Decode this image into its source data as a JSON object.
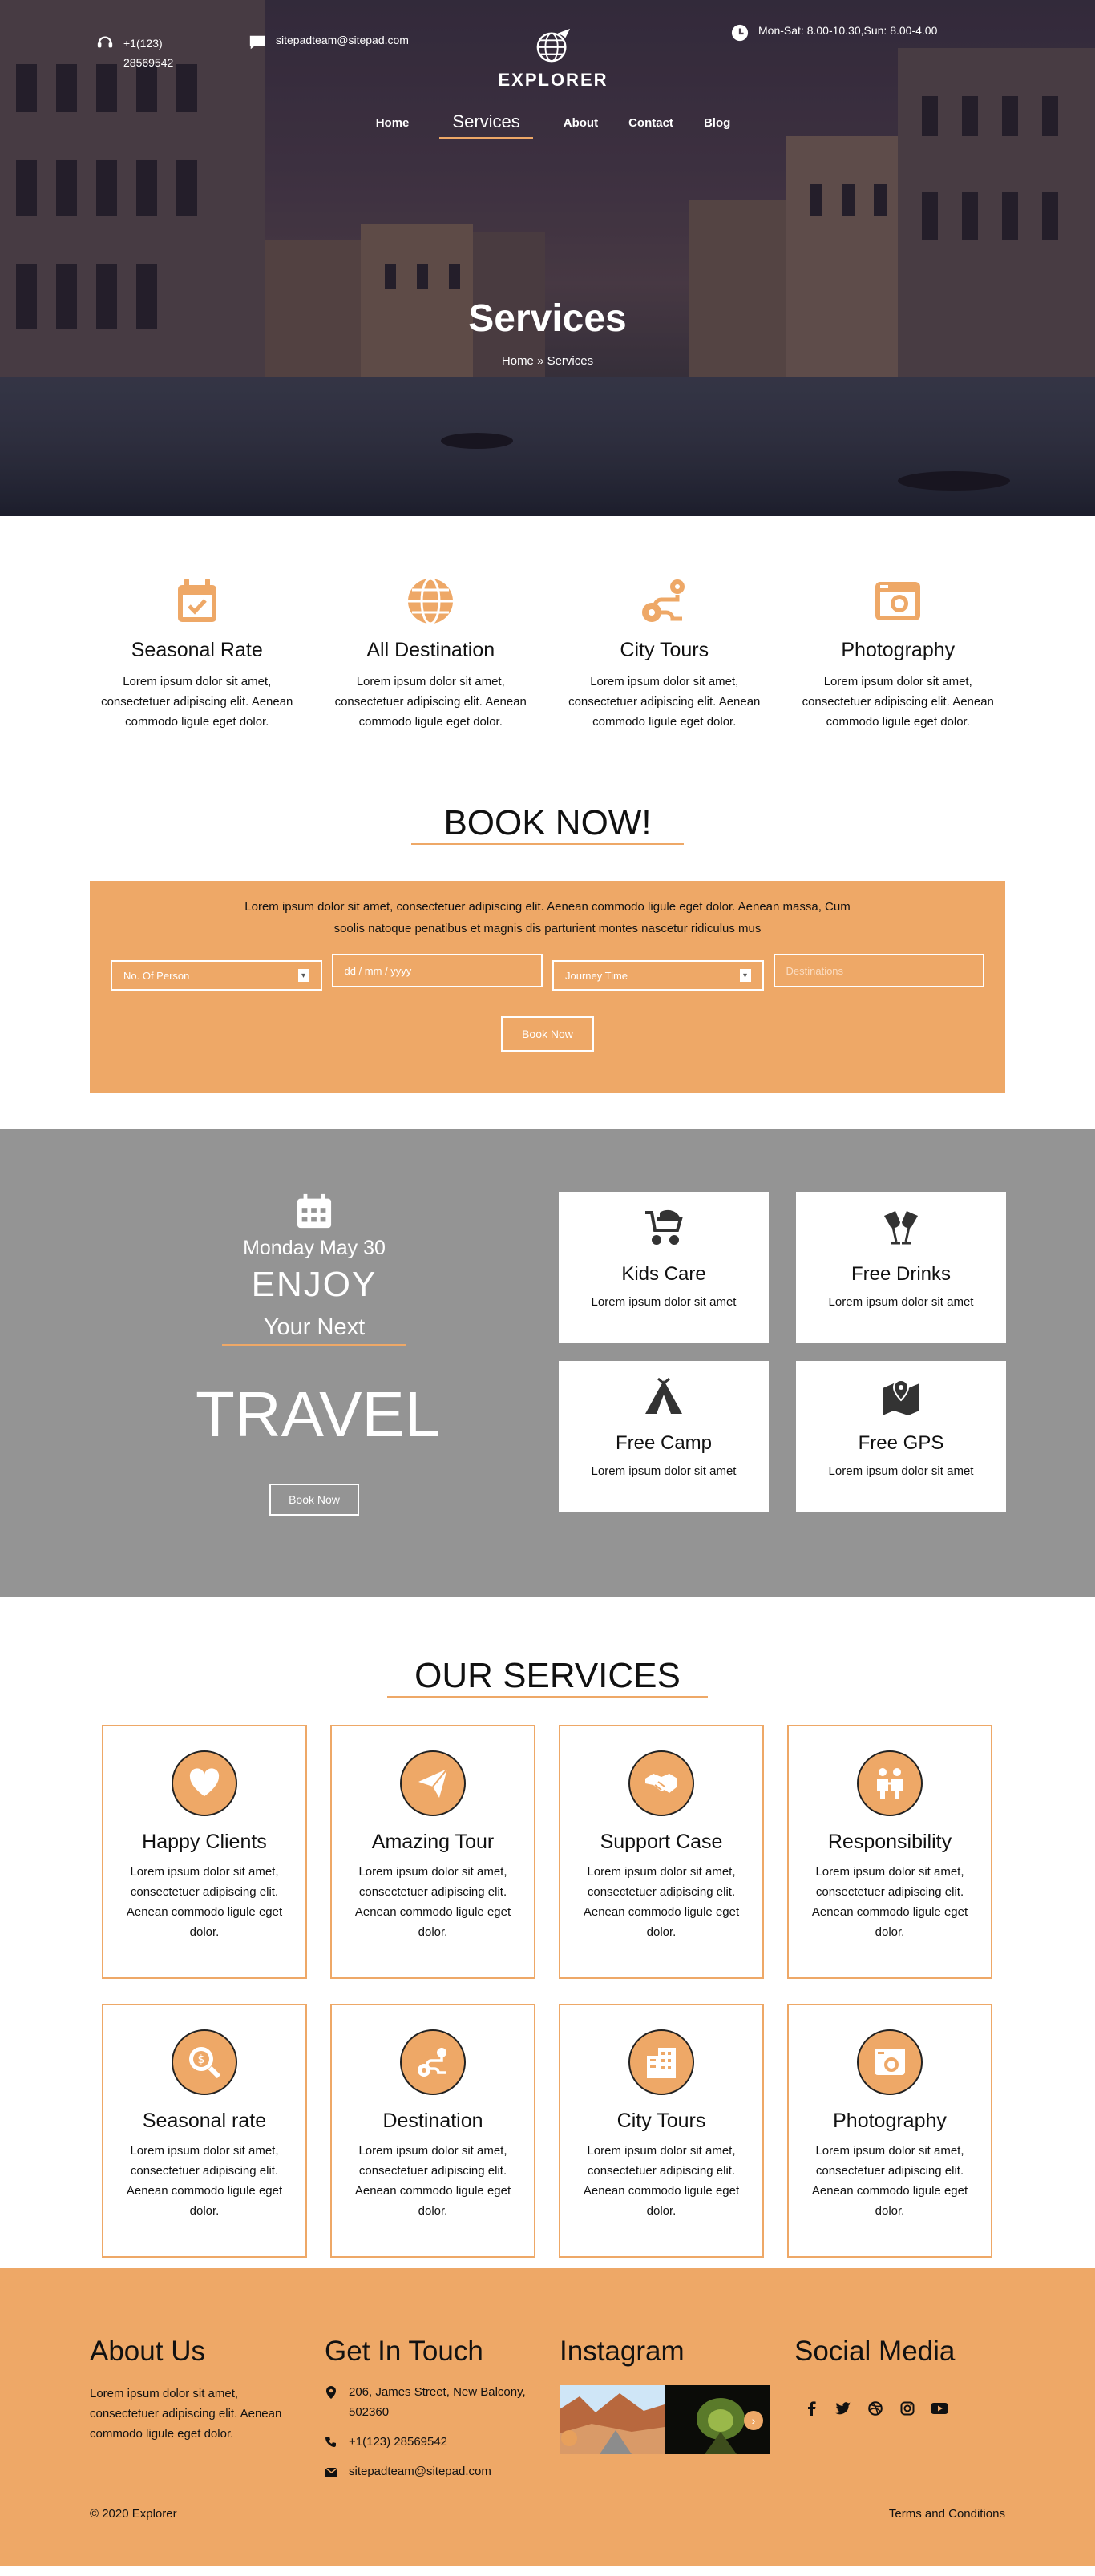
{
  "topbar": {
    "phone": "+1(123) 28569542",
    "email": "sitepadteam@sitepad.com",
    "hours": "Mon-Sat: 8.00-10.30,Sun: 8.00-4.00"
  },
  "brand": {
    "name": "EXPLORER"
  },
  "nav": [
    {
      "label": "Home"
    },
    {
      "label": "Services"
    },
    {
      "label": "About"
    },
    {
      "label": "Contact"
    },
    {
      "label": "Blog"
    }
  ],
  "hero": {
    "title": "Services",
    "breadcrumb": "Home » Services"
  },
  "features": [
    {
      "icon": "calendar-check-icon",
      "title": "Seasonal Rate",
      "text": "Lorem ipsum dolor sit amet, consectetuer adipiscing elit. Aenean commodo ligule eget dolor."
    },
    {
      "icon": "globe-icon",
      "title": "All Destination",
      "text": "Lorem ipsum dolor sit amet, consectetuer adipiscing elit. Aenean commodo ligule eget dolor."
    },
    {
      "icon": "route-icon",
      "title": "City Tours",
      "text": "Lorem ipsum dolor sit amet, consectetuer adipiscing elit. Aenean commodo ligule eget dolor."
    },
    {
      "icon": "camera-icon",
      "title": "Photography",
      "text": "Lorem ipsum dolor sit amet, consectetuer adipiscing elit. Aenean commodo ligule eget dolor."
    }
  ],
  "book": {
    "title": "BOOK NOW!",
    "text": "Lorem ipsum dolor sit amet, consectetuer adipiscing elit. Aenean commodo ligule eget dolor. Aenean massa, Cum soolis natoque penatibus et magnis dis parturient montes nascetur ridiculus mus",
    "persons": "No. Of Person",
    "date": "dd / mm / yyyy",
    "time": "Journey Time",
    "destination_placeholder": "Destinations",
    "button": "Book Now"
  },
  "promo": {
    "date": "Monday May 30",
    "enjoy": "ENJOY",
    "your_next": "Your Next",
    "travel": "TRAVEL",
    "button": "Book Now",
    "cards": [
      {
        "icon": "stroller-icon",
        "title": "Kids Care",
        "text": "Lorem ipsum dolor sit amet"
      },
      {
        "icon": "drinks-icon",
        "title": "Free Drinks",
        "text": "Lorem ipsum dolor sit amet"
      },
      {
        "icon": "tent-icon",
        "title": "Free Camp",
        "text": "Lorem ipsum dolor sit amet"
      },
      {
        "icon": "map-pin-icon",
        "title": "Free GPS",
        "text": "Lorem ipsum dolor sit amet"
      }
    ]
  },
  "services": {
    "title": "OUR SERVICES",
    "items": [
      {
        "icon": "heart-icon",
        "title": "Happy Clients",
        "text": "Lorem ipsum dolor sit amet, consectetuer adipiscing elit. Aenean commodo ligule eget dolor."
      },
      {
        "icon": "paper-plane-icon",
        "title": "Amazing Tour",
        "text": "Lorem ipsum dolor sit amet, consectetuer adipiscing elit. Aenean commodo ligule eget dolor."
      },
      {
        "icon": "handshake-icon",
        "title": "Support Case",
        "text": "Lorem ipsum dolor sit amet, consectetuer adipiscing elit. Aenean commodo ligule eget dolor."
      },
      {
        "icon": "people-icon",
        "title": "Responsibility",
        "text": "Lorem ipsum dolor sit amet, consectetuer adipiscing elit. Aenean commodo ligule eget dolor."
      },
      {
        "icon": "money-search-icon",
        "title": "Seasonal rate",
        "text": "Lorem ipsum dolor sit amet, consectetuer adipiscing elit. Aenean commodo ligule eget dolor."
      },
      {
        "icon": "route-icon",
        "title": "Destination",
        "text": "Lorem ipsum dolor sit amet, consectetuer adipiscing elit. Aenean commodo ligule eget dolor."
      },
      {
        "icon": "city-icon",
        "title": "City Tours",
        "text": "Lorem ipsum dolor sit amet, consectetuer adipiscing elit. Aenean commodo ligule eget dolor."
      },
      {
        "icon": "camera-icon",
        "title": "Photography",
        "text": "Lorem ipsum dolor sit amet, consectetuer adipiscing elit. Aenean commodo ligule eget dolor."
      }
    ]
  },
  "footer": {
    "about": {
      "title": "About Us",
      "text": "Lorem ipsum dolor sit amet, consectetuer adipiscing elit. Aenean commodo ligule eget dolor."
    },
    "touch": {
      "title": "Get In Touch",
      "address": "206, James Street, New Balcony, 502360",
      "phone": "+1(123) 28569542",
      "email": "sitepadteam@sitepad.com"
    },
    "instagram": {
      "title": "Instagram"
    },
    "social": {
      "title": "Social Media",
      "icons": [
        "facebook-icon",
        "twitter-icon",
        "dribbble-icon",
        "instagram-icon",
        "youtube-icon"
      ]
    },
    "copyright": "© 2020 Explorer",
    "terms": "Terms and Conditions"
  },
  "colors": {
    "accent": "#eea867",
    "promo_bg": "#949494",
    "text": "#111111"
  }
}
